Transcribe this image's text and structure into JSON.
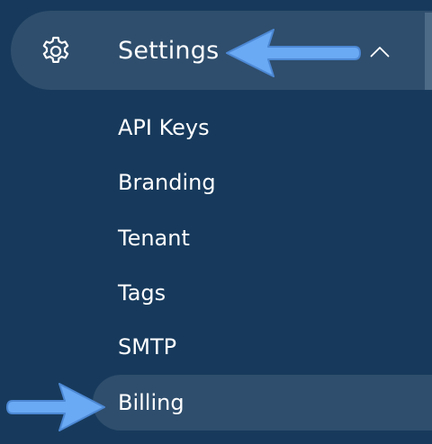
{
  "sidebar": {
    "section": {
      "label": "Settings",
      "icon": "gear-icon",
      "toggle_icon": "chevron-up-icon",
      "expanded": true
    },
    "items": [
      {
        "label": "API Keys"
      },
      {
        "label": "Branding"
      },
      {
        "label": "Tenant"
      },
      {
        "label": "Tags"
      },
      {
        "label": "SMTP"
      },
      {
        "label": "Billing",
        "selected": true
      }
    ]
  },
  "annotations": {
    "arrow_color": "#6aa9f4"
  },
  "colors": {
    "background": "#173a5c",
    "highlight": "#2f4e6d",
    "text": "#ffffff"
  }
}
